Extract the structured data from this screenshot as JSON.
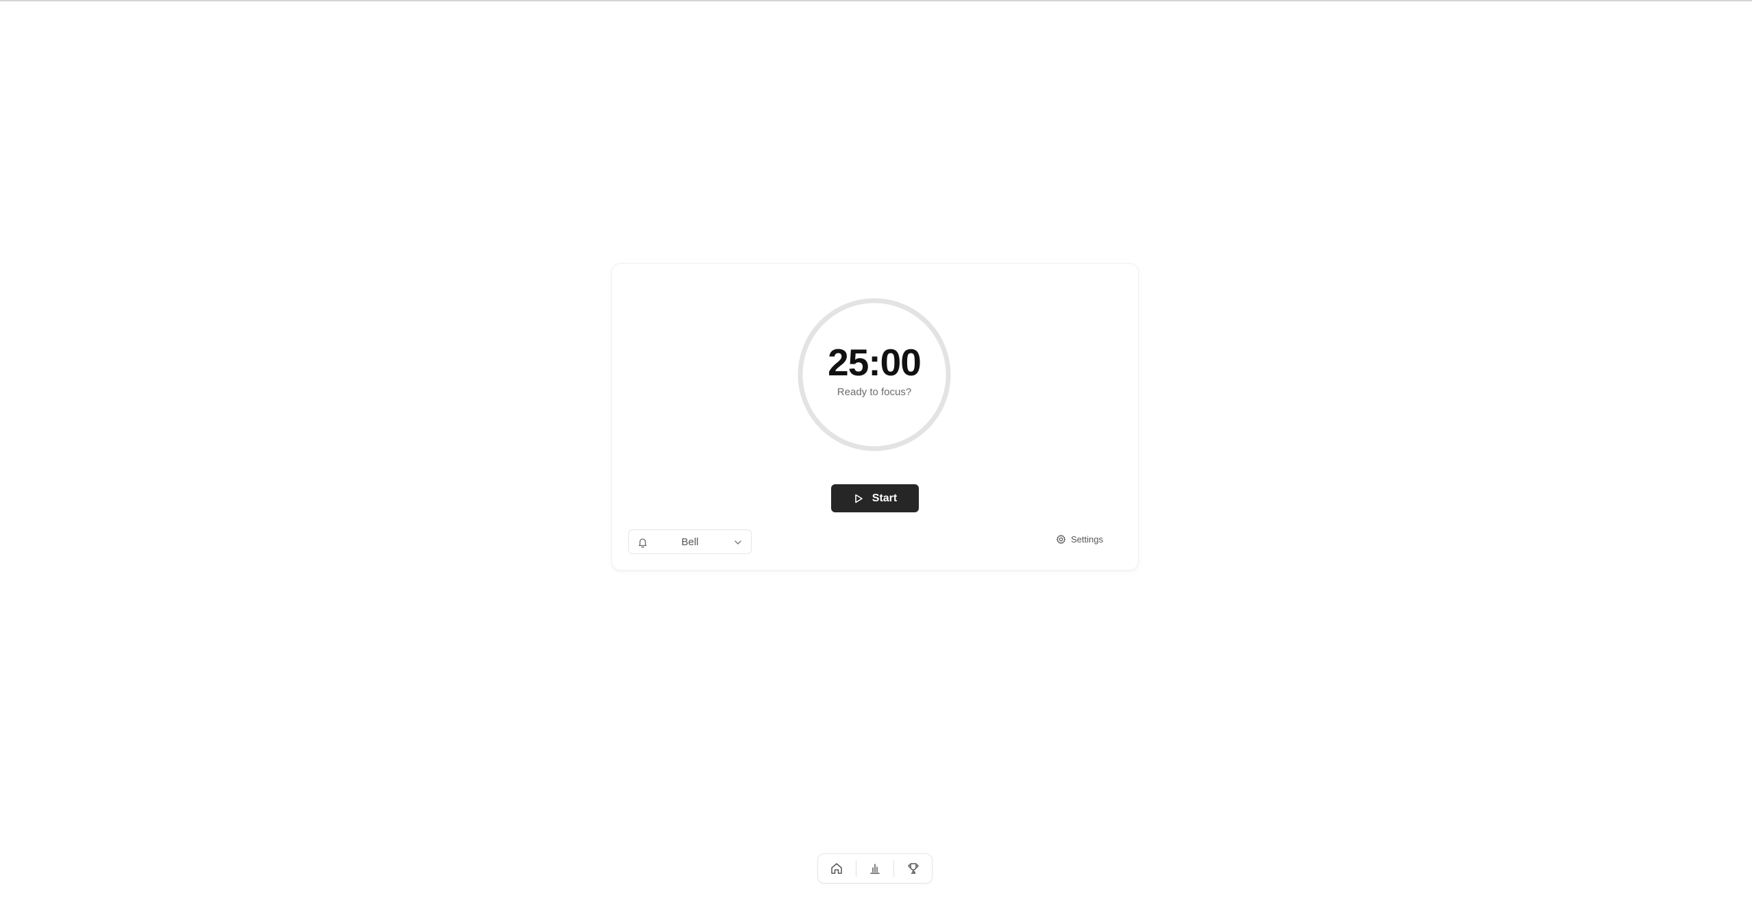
{
  "timer": {
    "display": "25:00",
    "status": "Ready to focus?",
    "progress": 0
  },
  "controls": {
    "start_label": "Start",
    "sound_label": "Bell",
    "settings_label": "Settings"
  },
  "icons": {
    "start": "play-icon",
    "sound": "bell-icon",
    "dropdown": "chevron-down-icon",
    "settings": "gear-icon",
    "nav_home": "home-icon",
    "nav_stats": "bar-chart-icon",
    "nav_achievements": "trophy-icon"
  },
  "colors": {
    "ring": "#e3e3e3",
    "button_bg": "#262626",
    "text_primary": "#111111",
    "text_muted": "#6b6b6b"
  }
}
